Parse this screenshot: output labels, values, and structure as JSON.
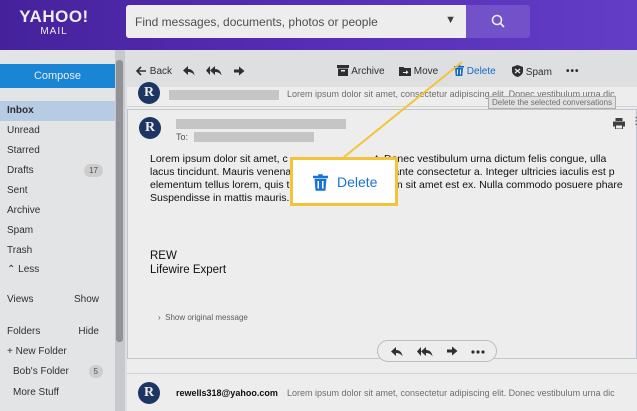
{
  "header": {
    "logo_line1": "YAHOO!",
    "logo_line2": "MAIL",
    "search_placeholder": "Find messages, documents, photos or people"
  },
  "sidebar": {
    "compose_label": "Compose",
    "folders": [
      {
        "label": "Inbox",
        "count": ""
      },
      {
        "label": "Unread",
        "count": ""
      },
      {
        "label": "Starred",
        "count": ""
      },
      {
        "label": "Drafts",
        "count": "17"
      },
      {
        "label": "Sent",
        "count": ""
      },
      {
        "label": "Archive",
        "count": ""
      },
      {
        "label": "Spam",
        "count": ""
      },
      {
        "label": "Trash",
        "count": ""
      }
    ],
    "less_label": "Less",
    "views_label": "Views",
    "views_toggle": "Show",
    "folders_label": "Folders",
    "folders_toggle": "Hide",
    "new_folder_label": "New Folder",
    "user_folders": [
      {
        "label": "Bob's Folder",
        "count": "5"
      },
      {
        "label": "More Stuff",
        "count": ""
      }
    ]
  },
  "toolbar": {
    "back_label": "Back",
    "archive_label": "Archive",
    "move_label": "Move",
    "delete_label": "Delete",
    "spam_label": "Spam",
    "more_label": "•••"
  },
  "messages": {
    "collapsed_snippet": "Lorem ipsum dolor sit amet, consectetur adipiscing elit. Donec vestibulum urna dic",
    "tooltip": "Delete the selected conversations",
    "to_label": "To:",
    "body": "Lorem ipsum dolor sit amet, c                              t. Donec vestibulum urna dictum felis congue, ulla\nlacus tincidunt. Mauris venena                            end ante consectetur a. Integer ultricies iaculis est p\nelementum tellus lorem, quis tin                          enean sit amet est ex. Nulla commodo posuere phare\nSuspendisse in mattis mauris.",
    "signature_name": "REW",
    "signature_title": "Lifewire Expert",
    "show_original": "Show original message",
    "bottom_sender": "rewells318@yahoo.com",
    "bottom_snippet": "Lorem ipsum dolor sit amet, consectetur adipiscing elit. Donec vestibulum urna dic",
    "avatar_letter": "R"
  },
  "callout": {
    "label": "Delete"
  },
  "colors": {
    "header_start": "#4b25a8",
    "compose_blue": "#1d8fe6",
    "callout_border": "#f3c43a",
    "delete_blue": "#1873d3"
  }
}
